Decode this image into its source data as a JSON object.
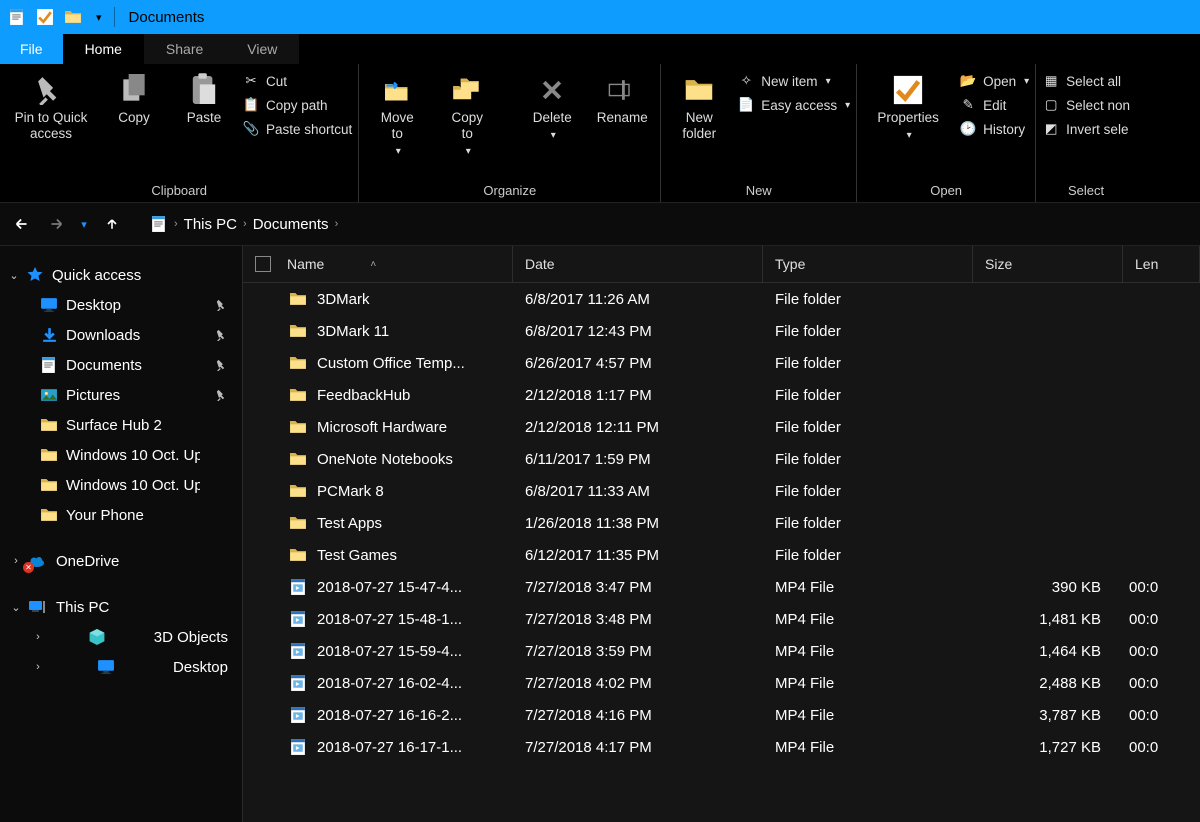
{
  "window": {
    "title": "Documents"
  },
  "tabs": {
    "file": "File",
    "items": [
      {
        "label": "Home",
        "active": true
      },
      {
        "label": "Share",
        "active": false
      },
      {
        "label": "View",
        "active": false
      }
    ]
  },
  "ribbon": {
    "groups": {
      "clipboard": {
        "label": "Clipboard",
        "pin": "Pin to Quick\naccess",
        "copy": "Copy",
        "paste": "Paste",
        "cut": "Cut",
        "copy_path": "Copy path",
        "paste_shortcut": "Paste shortcut"
      },
      "organize": {
        "label": "Organize",
        "move_to": "Move\nto",
        "copy_to": "Copy\nto",
        "delete": "Delete",
        "rename": "Rename"
      },
      "new": {
        "label": "New",
        "new_folder": "New\nfolder",
        "new_item": "New item",
        "easy_access": "Easy access"
      },
      "open": {
        "label": "Open",
        "properties": "Properties",
        "open": "Open",
        "edit": "Edit",
        "history": "History"
      },
      "select": {
        "label": "Select",
        "select_all": "Select all",
        "select_none": "Select non",
        "invert": "Invert sele"
      }
    }
  },
  "breadcrumb": {
    "root": "This PC",
    "leaf": "Documents"
  },
  "sidebar": {
    "quick_access": {
      "label": "Quick access",
      "items": [
        {
          "label": "Desktop",
          "icon": "desktop",
          "pinned": true
        },
        {
          "label": "Downloads",
          "icon": "download",
          "pinned": true
        },
        {
          "label": "Documents",
          "icon": "document",
          "pinned": true
        },
        {
          "label": "Pictures",
          "icon": "pictures",
          "pinned": true
        },
        {
          "label": "Surface Hub 2",
          "icon": "folder"
        },
        {
          "label": "Windows 10 Oct. Up",
          "icon": "folder"
        },
        {
          "label": "Windows 10 Oct. Up",
          "icon": "folder"
        },
        {
          "label": "Your Phone",
          "icon": "folder"
        }
      ]
    },
    "onedrive": {
      "label": "OneDrive"
    },
    "this_pc": {
      "label": "This PC",
      "items": [
        {
          "label": "3D Objects",
          "icon": "cube"
        },
        {
          "label": "Desktop",
          "icon": "desktop"
        }
      ]
    }
  },
  "columns": {
    "name": "Name",
    "date": "Date",
    "type": "Type",
    "size": "Size",
    "length": "Len"
  },
  "rows": [
    {
      "icon": "folder",
      "name": "3DMark",
      "date": "6/8/2017 11:26 AM",
      "type": "File folder",
      "size": "",
      "len": ""
    },
    {
      "icon": "folder",
      "name": "3DMark 11",
      "date": "6/8/2017 12:43 PM",
      "type": "File folder",
      "size": "",
      "len": ""
    },
    {
      "icon": "folder",
      "name": "Custom Office Temp...",
      "date": "6/26/2017 4:57 PM",
      "type": "File folder",
      "size": "",
      "len": ""
    },
    {
      "icon": "folder",
      "name": "FeedbackHub",
      "date": "2/12/2018 1:17 PM",
      "type": "File folder",
      "size": "",
      "len": ""
    },
    {
      "icon": "folder",
      "name": "Microsoft Hardware",
      "date": "2/12/2018 12:11 PM",
      "type": "File folder",
      "size": "",
      "len": ""
    },
    {
      "icon": "folder",
      "name": "OneNote Notebooks",
      "date": "6/11/2017 1:59 PM",
      "type": "File folder",
      "size": "",
      "len": ""
    },
    {
      "icon": "folder",
      "name": "PCMark 8",
      "date": "6/8/2017 11:33 AM",
      "type": "File folder",
      "size": "",
      "len": ""
    },
    {
      "icon": "folder",
      "name": "Test Apps",
      "date": "1/26/2018 11:38 PM",
      "type": "File folder",
      "size": "",
      "len": ""
    },
    {
      "icon": "folder",
      "name": "Test Games",
      "date": "6/12/2017 11:35 PM",
      "type": "File folder",
      "size": "",
      "len": ""
    },
    {
      "icon": "video",
      "name": "2018-07-27 15-47-4...",
      "date": "7/27/2018 3:47 PM",
      "type": "MP4 File",
      "size": "390 KB",
      "len": "00:0"
    },
    {
      "icon": "video",
      "name": "2018-07-27 15-48-1...",
      "date": "7/27/2018 3:48 PM",
      "type": "MP4 File",
      "size": "1,481 KB",
      "len": "00:0"
    },
    {
      "icon": "video",
      "name": "2018-07-27 15-59-4...",
      "date": "7/27/2018 3:59 PM",
      "type": "MP4 File",
      "size": "1,464 KB",
      "len": "00:0"
    },
    {
      "icon": "video",
      "name": "2018-07-27 16-02-4...",
      "date": "7/27/2018 4:02 PM",
      "type": "MP4 File",
      "size": "2,488 KB",
      "len": "00:0"
    },
    {
      "icon": "video",
      "name": "2018-07-27 16-16-2...",
      "date": "7/27/2018 4:16 PM",
      "type": "MP4 File",
      "size": "3,787 KB",
      "len": "00:0"
    },
    {
      "icon": "video",
      "name": "2018-07-27 16-17-1...",
      "date": "7/27/2018 4:17 PM",
      "type": "MP4 File",
      "size": "1,727 KB",
      "len": "00:0"
    }
  ]
}
